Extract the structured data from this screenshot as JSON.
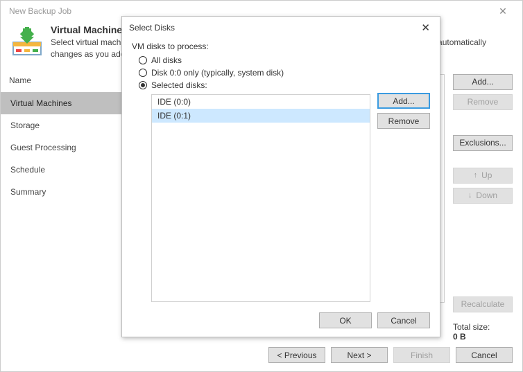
{
  "window": {
    "title": "New Backup Job",
    "close_glyph": "✕"
  },
  "header": {
    "heading": "Virtual Machines",
    "sub": "Select virtual machines to process via container, or granularly. Container provides dynamic selection that automatically changes as you add new VM into container."
  },
  "side": {
    "col_head": "Name",
    "items": [
      "Virtual Machines",
      "Storage",
      "Guest Processing",
      "Schedule",
      "Summary"
    ],
    "active_index": 0
  },
  "right_buttons": {
    "add": "Add...",
    "remove": "Remove",
    "exclusions": "Exclusions...",
    "up": "Up",
    "down": "Down",
    "recalculate": "Recalculate",
    "arrow_up": "↑",
    "arrow_down": "↓"
  },
  "total": {
    "label": "Total size:",
    "value": "0 B"
  },
  "footer": {
    "previous": "< Previous",
    "next": "Next >",
    "finish": "Finish",
    "cancel": "Cancel"
  },
  "modal": {
    "title": "Select Disks",
    "close_glyph": "✕",
    "group_label": "VM disks to process:",
    "opt_all": "All disks",
    "opt_disk0": "Disk 0:0 only (typically, system disk)",
    "opt_selected": "Selected disks:",
    "selected_index": 2,
    "disks": [
      "IDE (0:0)",
      "IDE (0:1)"
    ],
    "disk_selected_index": 1,
    "add": "Add...",
    "remove": "Remove",
    "ok": "OK",
    "cancel": "Cancel"
  }
}
